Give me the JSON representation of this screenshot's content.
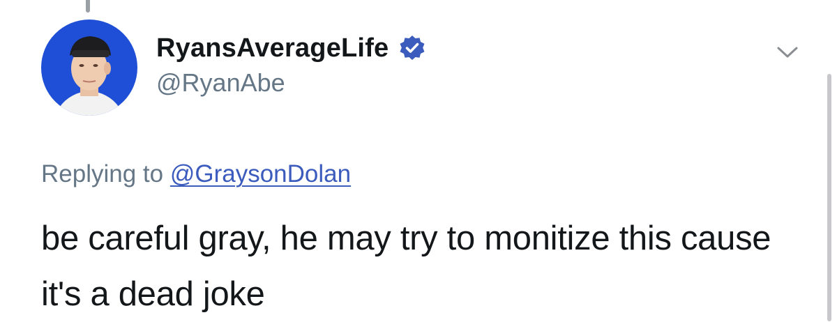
{
  "tweet": {
    "author": {
      "display_name": "RyansAverageLife",
      "handle": "@RyanAbe",
      "verified": true,
      "avatar_icon": "profile-photo"
    },
    "reply_context": {
      "prefix": "Replying to",
      "mention": "@GraysonDolan"
    },
    "text": "be careful gray, he may try to monitize this cause it's a dead joke"
  },
  "colors": {
    "text_primary": "#14171a",
    "text_secondary": "#657786",
    "link": "#3b5bbd",
    "verified_badge": "#3b5bbd",
    "avatar_background": "#1f4fd6"
  },
  "icons": {
    "verified": "verified-badge-icon",
    "menu": "chevron-down-icon"
  }
}
